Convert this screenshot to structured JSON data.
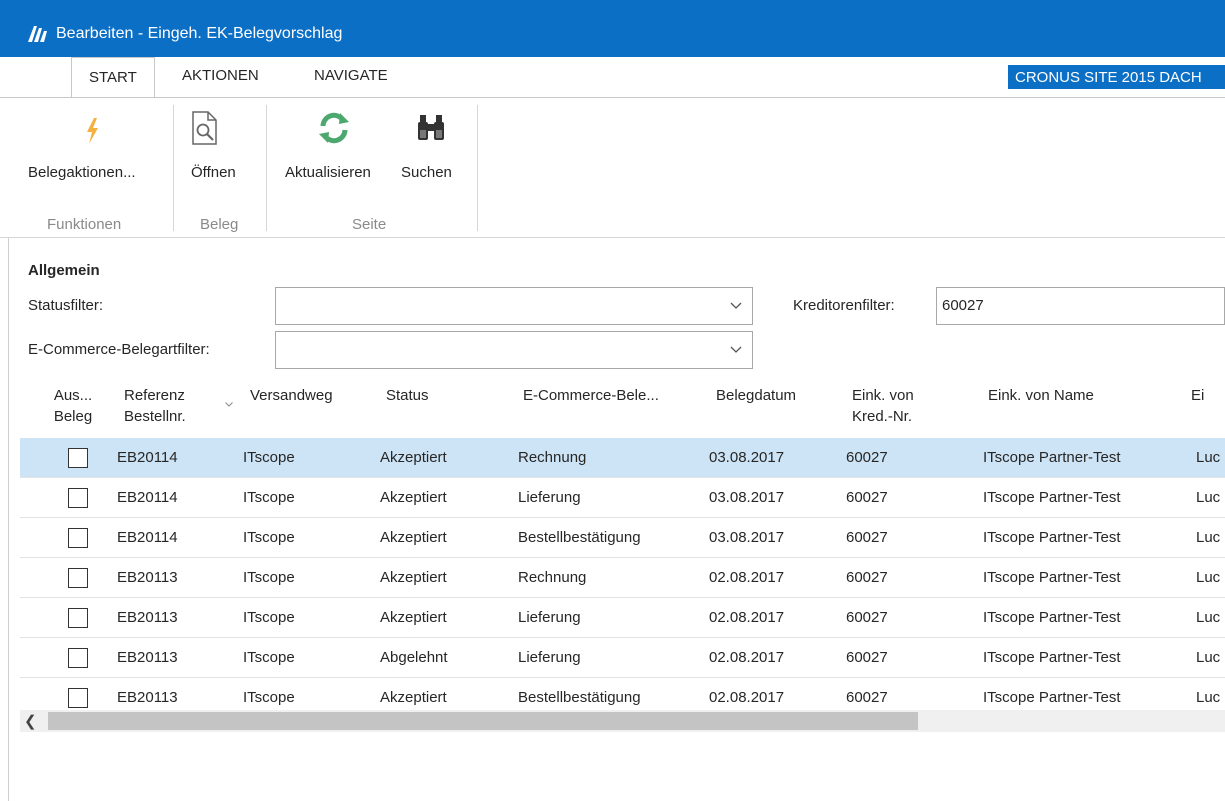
{
  "window": {
    "title": "Bearbeiten - Eingeh. EK-Belegvorschlag"
  },
  "tabs": [
    {
      "label": "START",
      "active": true
    },
    {
      "label": "AKTIONEN",
      "active": false
    },
    {
      "label": "NAVIGATE",
      "active": false
    }
  ],
  "company": "CRONUS SITE 2015 DACH",
  "ribbon": {
    "groups": {
      "funktionen": "Funktionen",
      "beleg": "Beleg",
      "seite": "Seite"
    },
    "buttons": {
      "belegaktionen": "Belegaktionen...",
      "oeffnen": "Öffnen",
      "aktualisieren": "Aktualisieren",
      "suchen": "Suchen"
    }
  },
  "form": {
    "section_title": "Allgemein",
    "status_filter_label": "Statusfilter:",
    "status_filter_value": "",
    "ecommerce_filter_label": "E-Commerce-Belegartfilter:",
    "ecommerce_filter_value": "",
    "kreditoren_filter_label": "Kreditorenfilter:",
    "kreditoren_filter_value": "60027"
  },
  "table": {
    "headers": {
      "aus_beleg_1": "Aus...",
      "aus_beleg_2": "Beleg",
      "referenz_1": "Referenz",
      "referenz_2": "Bestellnr.",
      "versandweg": "Versandweg",
      "status": "Status",
      "ecommerce": "E-Commerce-Bele...",
      "belegdatum": "Belegdatum",
      "eink_kred_1": "Eink. von",
      "eink_kred_2": "Kred.-Nr.",
      "eink_name": "Eink. von Name",
      "next": "Ei"
    },
    "rows": [
      {
        "ref": "EB20114",
        "versand": "ITscope",
        "status": "Akzeptiert",
        "art": "Rechnung",
        "datum": "03.08.2017",
        "kred": "60027",
        "name": "ITscope Partner-Test",
        "next": "Luc"
      },
      {
        "ref": "EB20114",
        "versand": "ITscope",
        "status": "Akzeptiert",
        "art": "Lieferung",
        "datum": "03.08.2017",
        "kred": "60027",
        "name": "ITscope Partner-Test",
        "next": "Luc"
      },
      {
        "ref": "EB20114",
        "versand": "ITscope",
        "status": "Akzeptiert",
        "art": "Bestellbestätigung",
        "datum": "03.08.2017",
        "kred": "60027",
        "name": "ITscope Partner-Test",
        "next": "Luc"
      },
      {
        "ref": "EB20113",
        "versand": "ITscope",
        "status": "Akzeptiert",
        "art": "Rechnung",
        "datum": "02.08.2017",
        "kred": "60027",
        "name": "ITscope Partner-Test",
        "next": "Luc"
      },
      {
        "ref": "EB20113",
        "versand": "ITscope",
        "status": "Akzeptiert",
        "art": "Lieferung",
        "datum": "02.08.2017",
        "kred": "60027",
        "name": "ITscope Partner-Test",
        "next": "Luc"
      },
      {
        "ref": "EB20113",
        "versand": "ITscope",
        "status": "Abgelehnt",
        "art": "Lieferung",
        "datum": "02.08.2017",
        "kred": "60027",
        "name": "ITscope Partner-Test",
        "next": "Luc"
      },
      {
        "ref": "EB20113",
        "versand": "ITscope",
        "status": "Akzeptiert",
        "art": "Bestellbestätigung",
        "datum": "02.08.2017",
        "kred": "60027",
        "name": "ITscope Partner-Test",
        "next": "Luc"
      }
    ]
  },
  "colors": {
    "accent": "#0c6fc6",
    "selected_row": "#cde4f6"
  }
}
